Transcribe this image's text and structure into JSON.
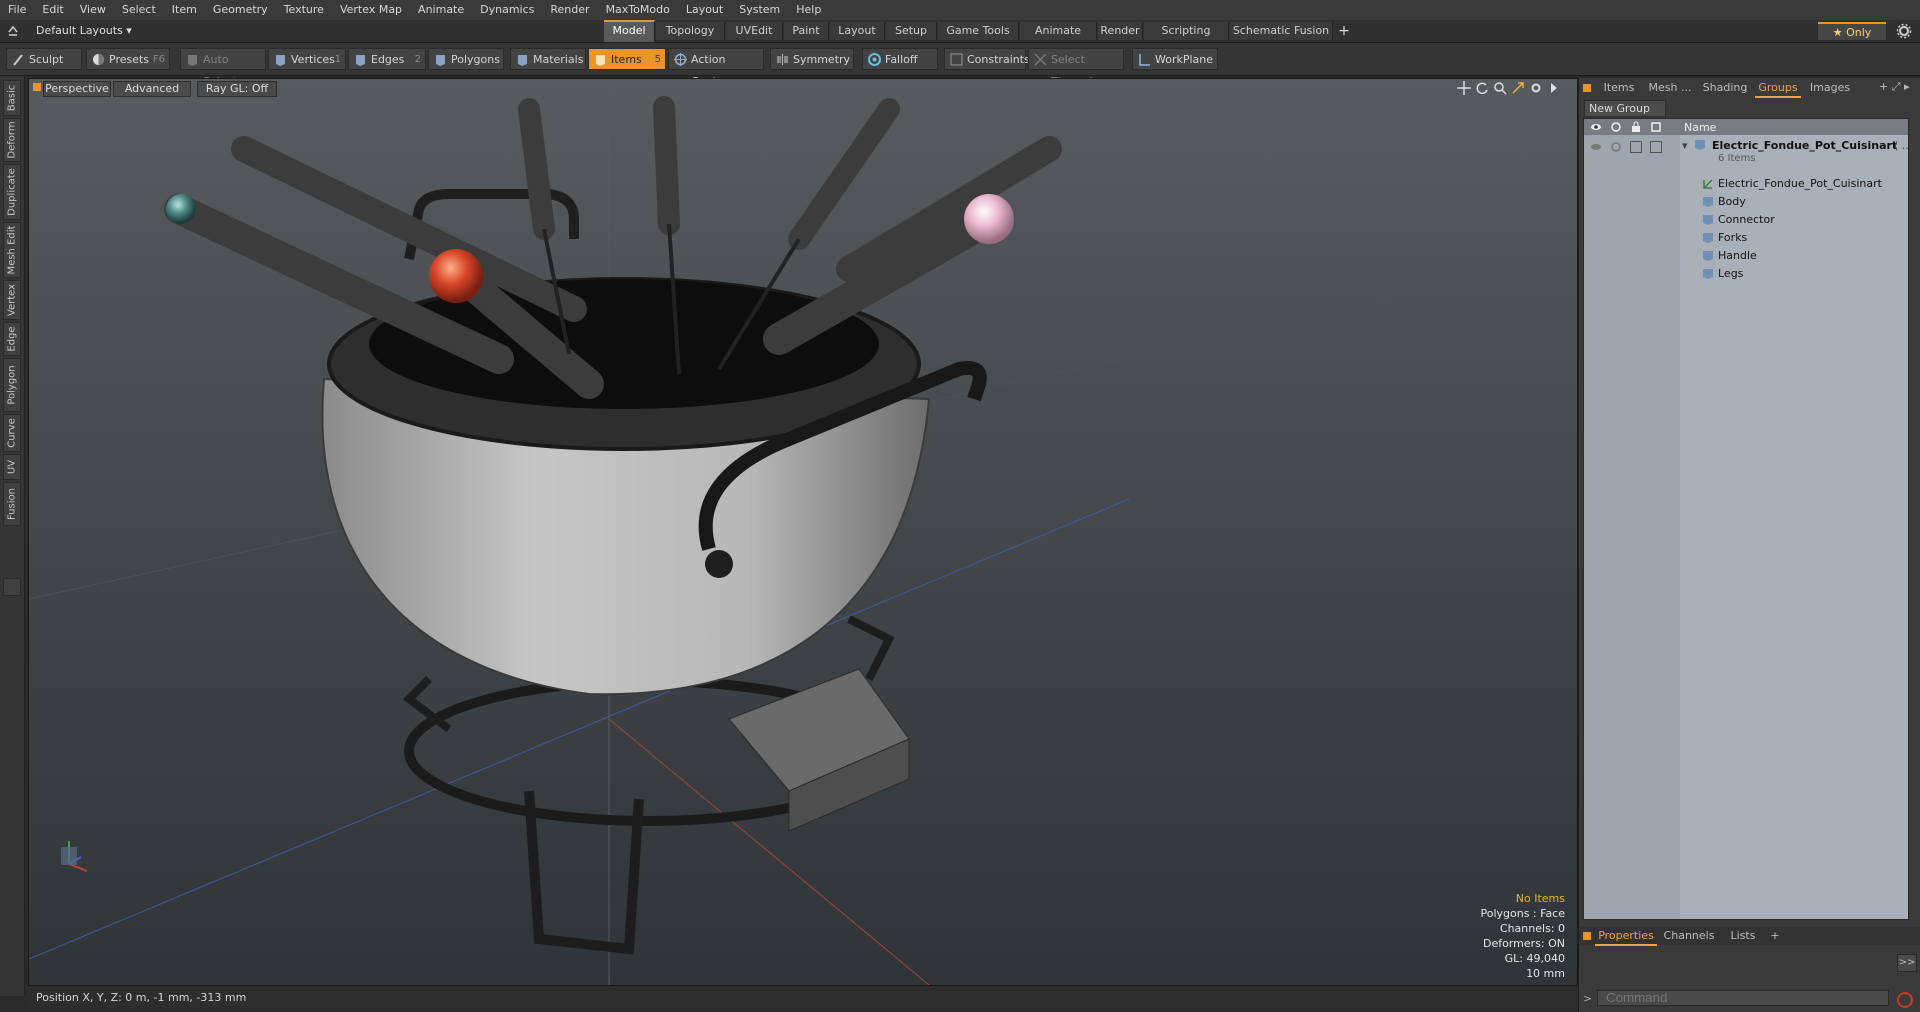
{
  "menu": [
    "File",
    "Edit",
    "View",
    "Select",
    "Item",
    "Geometry",
    "Texture",
    "Vertex Map",
    "Animate",
    "Dynamics",
    "Render",
    "MaxToModo",
    "Layout",
    "System",
    "Help"
  ],
  "layout_selector": "Default Layouts ▾",
  "layout_tabs": [
    "Model",
    "Topology",
    "UVEdit",
    "Paint",
    "Layout",
    "Setup",
    "Game Tools",
    "Animate",
    "Render",
    "Scripting",
    "Schematic Fusion"
  ],
  "layout_plus": "+",
  "only_label": "★ Only",
  "toolbar": {
    "sculpt": "Sculpt",
    "presets": "Presets",
    "presets_key": "F6",
    "auto_select": "Auto Select",
    "vertices": "Vertices",
    "vertices_count": "1",
    "edges": "Edges",
    "edges_count": "2",
    "polygons": "Polygons",
    "materials": "Materials",
    "items": "Items",
    "items_count": "5",
    "action_center": "Action Center",
    "symmetry": "Symmetry",
    "falloff": "Falloff",
    "constraints": "Constraints",
    "select_through": "Select Through",
    "workplane": "WorkPlane"
  },
  "left_tabs": [
    "Basic",
    "Deform",
    "Duplicate",
    "Mesh Edit",
    "Vertex",
    "Edge",
    "Polygon",
    "Curve",
    "UV",
    "Fusion"
  ],
  "viewport": {
    "view": "Perspective",
    "shading": "Advanced",
    "raygl": "Ray GL: Off",
    "info": {
      "no_items": "No Items",
      "polygons": "Polygons : Face",
      "channels": "Channels: 0",
      "deformers": "Deformers: ON",
      "gl": "GL: 49,040",
      "scale": "10 mm"
    }
  },
  "status": "Position X, Y, Z:   0 m, -1 mm, -313 mm",
  "right_panel": {
    "tabs": [
      "Items",
      "Mesh ...",
      "Shading",
      "Groups",
      "Images"
    ],
    "active_tab": "Groups",
    "new_group": "New Group",
    "name_header": "Name",
    "group_name": "Electric_Fondue_Pot_Cuisinart",
    "group_suffix": "( ...",
    "group_count": "6 Items",
    "children": [
      "Electric_Fondue_Pot_Cuisinart",
      "Body",
      "Connector",
      "Forks",
      "Handle",
      "Legs"
    ],
    "bottom_tabs": [
      "Properties",
      "Channels",
      "Lists"
    ],
    "bottom_plus": "+",
    "expand": ">>",
    "command_placeholder": "Command"
  },
  "colors": {
    "accent": "#e8952b",
    "tab_active_text": "#f3a43a",
    "tree_bg": "#a9b0b7"
  }
}
